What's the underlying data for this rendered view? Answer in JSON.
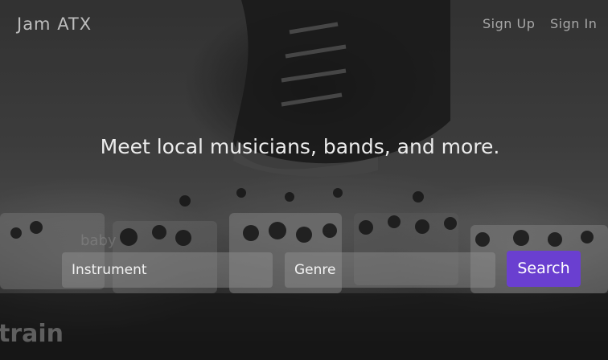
{
  "nav": {
    "brand": "Jam ATX",
    "links": [
      {
        "label": "Sign Up"
      },
      {
        "label": "Sign In"
      }
    ]
  },
  "hero": {
    "headline": "Meet local musicians, bands, and more."
  },
  "search": {
    "instrument_placeholder": "Instrument",
    "genre_placeholder": "Genre",
    "button_label": "Search"
  },
  "colors": {
    "accent": "#6a3fd0",
    "overlay": "#2f2f2f"
  }
}
